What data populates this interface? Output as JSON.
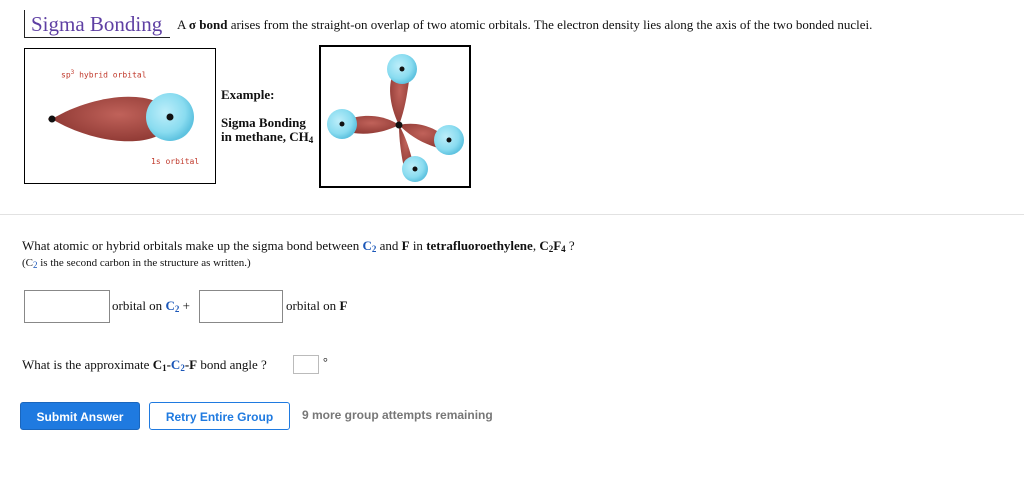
{
  "header": {
    "title": "Sigma Bonding",
    "intro_a": "A",
    "intro_sigma": "σ",
    "intro_bond": "bond",
    "intro_rest": "arises from the straight-on overlap of two atomic orbitals. The electron density lies along the axis of the two bonded nuclei."
  },
  "diagram1": {
    "top_label_pre": "sp",
    "top_label_sup": "3",
    "top_label_post": " hybrid orbital",
    "bottom_label": "1s orbital"
  },
  "diagram_text": {
    "example": "Example:",
    "sigma_line1": "Sigma Bonding",
    "sigma_line2_pre": "in methane, CH",
    "sigma_line2_sub": "4"
  },
  "question1": {
    "pre": "What atomic or hybrid orbitals make up the sigma bond between ",
    "c": "C",
    "c_sub": "2",
    "mid": " and ",
    "f": "F",
    "in": " in ",
    "compound": "tetrafluoroethylene",
    "comma": ", ",
    "formula_c": "C",
    "formula_c_sub": "2",
    "formula_f": "F",
    "formula_f_sub": "4",
    "end": " ?",
    "note_pre": "(C",
    "note_sub": "2",
    "note_post": " is the second carbon in the structure as written.)"
  },
  "answer1": {
    "orbital_c_pre": "orbital on ",
    "orbital_c": "C",
    "orbital_c_sub": "2",
    "plus": " +",
    "orbital_f_pre": "orbital on ",
    "orbital_f": "F",
    "input1_value": "",
    "input2_value": ""
  },
  "question2": {
    "pre": "What is the approximate ",
    "c1": "C",
    "c1_sub": "1",
    "dash1": "-",
    "c2": "C",
    "c2_sub": "2",
    "dash2": "-",
    "f": "F",
    "post": " bond angle ?",
    "input_value": "",
    "unit": "°"
  },
  "actions": {
    "submit": "Submit Answer",
    "retry": "Retry Entire Group",
    "remaining": "9 more group attempts remaining"
  },
  "colors": {
    "title": "#5e3fa3",
    "lobe": "#a0453f",
    "sphere": "#7fd6ee",
    "accent": "#1f7ae0"
  }
}
